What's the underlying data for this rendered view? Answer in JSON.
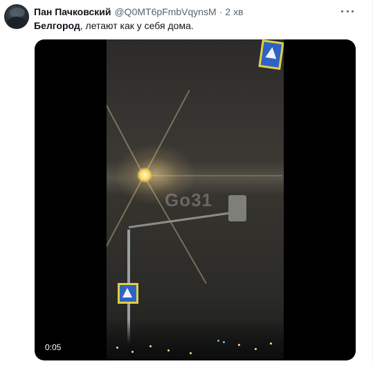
{
  "tweet": {
    "display_name": "Пан Пачковский",
    "handle": "@Q0MT6pFmbVqynsM",
    "separator": "·",
    "time": "2 хв",
    "hashtag": "Белгород",
    "text": ", летают как у себя дома."
  },
  "video": {
    "timestamp": "0:05",
    "watermark": "Go31"
  },
  "colors": {
    "text_primary": "#0f1419",
    "text_secondary": "#536471"
  },
  "icons": {
    "more": "more-horizontal-icon"
  }
}
